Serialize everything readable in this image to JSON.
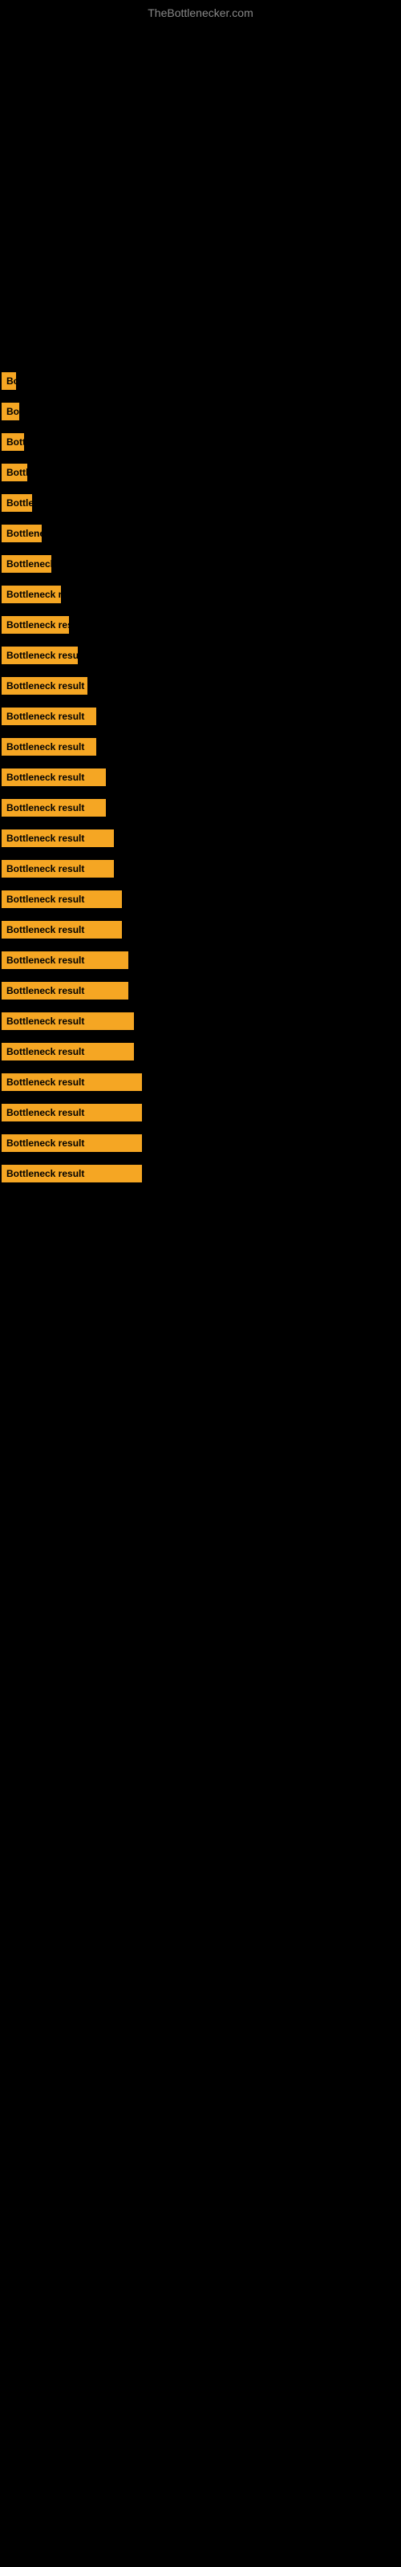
{
  "site": {
    "title": "TheBottlenecker.com"
  },
  "items": [
    {
      "label": "Bottleneck result",
      "size": "w-10",
      "visible": "B"
    },
    {
      "label": "Bottleneck result",
      "size": "w-15",
      "visible": "B"
    },
    {
      "label": "Bottleneck result",
      "size": "w-20",
      "visible": "Bo"
    },
    {
      "label": "Bottleneck result",
      "size": "w-25",
      "visible": "Bo"
    },
    {
      "label": "Bottleneck result",
      "size": "w-30",
      "visible": "Bo"
    },
    {
      "label": "Bottleneck result",
      "size": "w-40",
      "visible": "Bottlene"
    },
    {
      "label": "Bottleneck result",
      "size": "w-50",
      "visible": "Bottleneck r"
    },
    {
      "label": "Bottleneck result",
      "size": "w-60",
      "visible": "Bottleneck"
    },
    {
      "label": "Bottleneck result",
      "size": "w-70",
      "visible": "Bottleneck res"
    },
    {
      "label": "Bottleneck result",
      "size": "w-80",
      "visible": "Bottleneck result"
    },
    {
      "label": "Bottleneck result",
      "size": "w-90",
      "visible": "Bottleneck res"
    },
    {
      "label": "Bottleneck result",
      "size": "w-100",
      "visible": "Bottleneck resul"
    },
    {
      "label": "Bottleneck result",
      "size": "w-100",
      "visible": "Bottleneck r"
    },
    {
      "label": "Bottleneck result",
      "size": "w-110",
      "visible": "Bottleneck result"
    },
    {
      "label": "Bottleneck result",
      "size": "w-110",
      "visible": "Bottleneck res"
    },
    {
      "label": "Bottleneck result",
      "size": "w-120",
      "visible": "Bottleneck result"
    },
    {
      "label": "Bottleneck result",
      "size": "w-120",
      "visible": "Bottleneck result"
    },
    {
      "label": "Bottleneck result",
      "size": "w-130",
      "visible": "Bottleneck result"
    },
    {
      "label": "Bottleneck result",
      "size": "w-130",
      "visible": "Bottleneck result"
    },
    {
      "label": "Bottleneck result",
      "size": "w-140",
      "visible": "Bottleneck result"
    },
    {
      "label": "Bottleneck result",
      "size": "w-140",
      "visible": "Bottleneck result"
    },
    {
      "label": "Bottleneck result",
      "size": "w-150",
      "visible": "Bottleneck result"
    },
    {
      "label": "Bottleneck result",
      "size": "w-150",
      "visible": "Bottleneck result"
    },
    {
      "label": "Bottleneck result",
      "size": "w-full",
      "visible": "Bottleneck result"
    },
    {
      "label": "Bottleneck result",
      "size": "w-full",
      "visible": "Bottleneck result"
    },
    {
      "label": "Bottleneck result",
      "size": "w-full",
      "visible": "Bottleneck result"
    },
    {
      "label": "Bottleneck result",
      "size": "w-full",
      "visible": "Bottleneck result"
    }
  ]
}
